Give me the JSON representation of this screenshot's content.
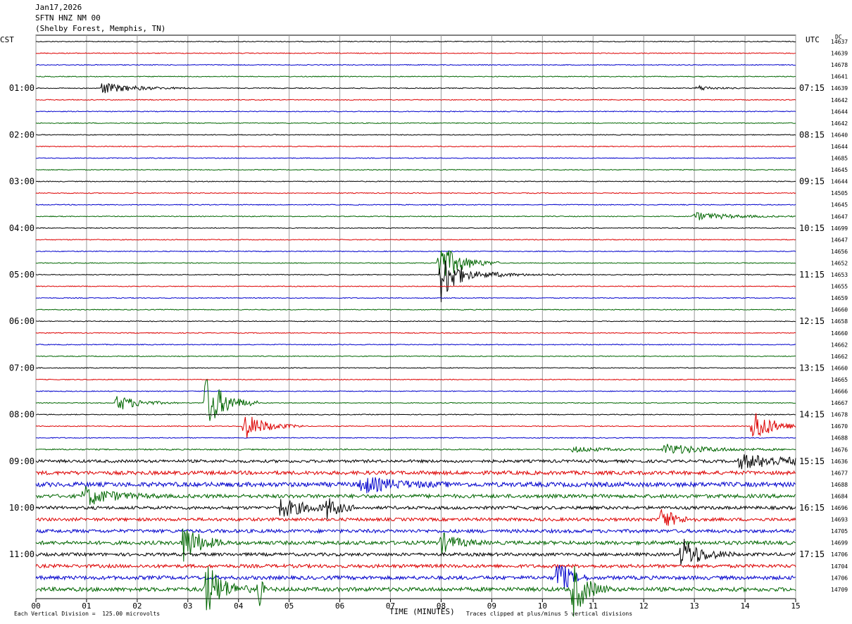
{
  "header": {
    "date": "Jan17,2026",
    "station": "SFTN HNZ NM 00",
    "location": "(Shelby Forest, Memphis, TN)"
  },
  "labels": {
    "left_tz": "CST",
    "right_tz": "UTC",
    "dc": "DC",
    "xlabel": "TIME (MINUTES)",
    "scale_note": "Each Vertical Division =  125.00 microvolts",
    "clip_note": "Traces clipped at plus/minus 5 vertical divisions"
  },
  "chart_data": {
    "type": "helicorder",
    "xlim": [
      0,
      15
    ],
    "x_ticks": [
      "00",
      "01",
      "02",
      "03",
      "04",
      "05",
      "06",
      "07",
      "08",
      "09",
      "10",
      "11",
      "12",
      "13",
      "14",
      "15"
    ],
    "row_minutes": 15,
    "grid": true,
    "trace_colors": [
      "#000000",
      "#dd0000",
      "#0000cc",
      "#006600"
    ],
    "left_hour_labels": [
      "01:00",
      "02:00",
      "03:00",
      "04:00",
      "05:00",
      "06:00",
      "07:00",
      "08:00",
      "09:00",
      "10:00",
      "11:00"
    ],
    "right_hour_labels": [
      "07:15",
      "08:15",
      "09:15",
      "10:15",
      "11:15",
      "12:15",
      "13:15",
      "14:15",
      "15:15",
      "16:15",
      "17:15"
    ],
    "hour_label_rows": [
      4,
      8,
      12,
      16,
      20,
      24,
      28,
      32,
      36,
      40,
      44
    ],
    "dc_values": [
      "14637",
      "14639",
      "14678",
      "14641",
      "14639",
      "14642",
      "14644",
      "14642",
      "14640",
      "14644",
      "14685",
      "14645",
      "14644",
      "14505",
      "14645",
      "14647",
      "14699",
      "14647",
      "14656",
      "14652",
      "14653",
      "14655",
      "14659",
      "14660",
      "14658",
      "14660",
      "14662",
      "14662",
      "14660",
      "14665",
      "14666",
      "14667",
      "14678",
      "14670",
      "14688",
      "14676",
      "14636",
      "14677",
      "14688",
      "14684",
      "14696",
      "14693",
      "14705",
      "14699",
      "14706",
      "14704",
      "14706",
      "14709"
    ],
    "noise": [
      0.6,
      0.6,
      0.6,
      0.6,
      0.6,
      0.6,
      0.6,
      0.6,
      0.6,
      0.6,
      0.6,
      0.6,
      0.6,
      0.6,
      0.6,
      0.6,
      0.6,
      0.6,
      0.6,
      0.6,
      0.6,
      0.6,
      0.6,
      0.6,
      0.6,
      0.6,
      0.6,
      0.6,
      0.6,
      0.6,
      0.6,
      0.6,
      0.6,
      0.6,
      0.6,
      0.9,
      2.0,
      2.6,
      3.2,
      2.6,
      2.2,
      2.2,
      2.4,
      2.6,
      2.2,
      2.4,
      2.6,
      2.8
    ],
    "events": [
      {
        "row": 4,
        "minute": 1.3,
        "amp": 8,
        "dur": 0.6
      },
      {
        "row": 4,
        "minute": 13.05,
        "amp": 4,
        "dur": 0.3
      },
      {
        "row": 15,
        "minute": 13.0,
        "amp": 6,
        "dur": 0.7
      },
      {
        "row": 19,
        "minute": 7.95,
        "amp": 30,
        "dur": 0.4
      },
      {
        "row": 20,
        "minute": 8.0,
        "amp": 40,
        "dur": 0.3
      },
      {
        "row": 20,
        "minute": 8.9,
        "amp": 4,
        "dur": 0.6
      },
      {
        "row": 31,
        "minute": 1.6,
        "amp": 12,
        "dur": 0.4
      },
      {
        "row": 31,
        "minute": 3.35,
        "amp": 40,
        "dur": 0.35
      },
      {
        "row": 33,
        "minute": 4.1,
        "amp": 20,
        "dur": 0.4
      },
      {
        "row": 33,
        "minute": 14.15,
        "amp": 26,
        "dur": 0.35
      },
      {
        "row": 35,
        "minute": 12.4,
        "amp": 8,
        "dur": 0.8
      },
      {
        "row": 35,
        "minute": 10.6,
        "amp": 4,
        "dur": 0.6
      },
      {
        "row": 36,
        "minute": 13.9,
        "amp": 10,
        "dur": 1.0
      },
      {
        "row": 38,
        "minute": 6.4,
        "amp": 12,
        "dur": 0.6
      },
      {
        "row": 39,
        "minute": 0.95,
        "amp": 14,
        "dur": 0.5
      },
      {
        "row": 40,
        "minute": 4.8,
        "amp": 14,
        "dur": 0.5
      },
      {
        "row": 40,
        "minute": 5.75,
        "amp": 14,
        "dur": 0.2
      },
      {
        "row": 41,
        "minute": 12.35,
        "amp": 16,
        "dur": 0.25
      },
      {
        "row": 43,
        "minute": 2.9,
        "amp": 30,
        "dur": 0.3
      },
      {
        "row": 43,
        "minute": 8.0,
        "amp": 14,
        "dur": 0.3
      },
      {
        "row": 44,
        "minute": 12.75,
        "amp": 24,
        "dur": 0.35
      },
      {
        "row": 46,
        "minute": 10.3,
        "amp": 30,
        "dur": 0.2
      },
      {
        "row": 47,
        "minute": 3.35,
        "amp": 40,
        "dur": 0.3
      },
      {
        "row": 47,
        "minute": 10.6,
        "amp": 40,
        "dur": 0.25
      },
      {
        "row": 47,
        "minute": 4.4,
        "amp": 36,
        "dur": 0.05
      }
    ]
  }
}
